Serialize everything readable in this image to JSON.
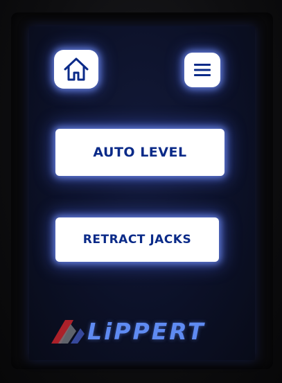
{
  "header": {
    "home_icon": "home-icon",
    "menu_icon": "hamburger-menu-icon"
  },
  "actions": {
    "auto_level_label": "AUTO LEVEL",
    "retract_jacks_label": "RETRACT JACKS"
  },
  "brand": {
    "name": "LiPPERT",
    "text_color": "#5f8bf2",
    "mark_colors": [
      "#c8242b",
      "#6f7278"
    ]
  },
  "theme": {
    "button_bg": "#ffffff",
    "button_text": "#0a2a88",
    "glow": "#6a8cff"
  }
}
